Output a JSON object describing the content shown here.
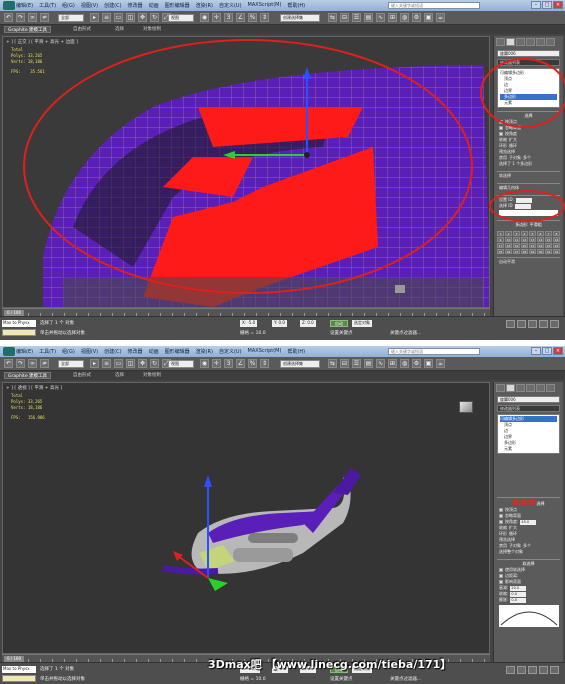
{
  "app": {
    "title": "Autodesk 3ds Max 2013",
    "search_placeholder": "键入关键字或短语",
    "menus": [
      "编辑(E)",
      "工具(T)",
      "组(G)",
      "视图(V)",
      "创建(C)",
      "修改器",
      "动画",
      "图形编辑器",
      "渲染(R)",
      "自定义(U)",
      "MAXScript(M)",
      "帮助(H)"
    ],
    "selection_filter": "全部",
    "ref_coord": "视图",
    "named_selection": "创建选择集",
    "ribbon_tabs": [
      "Graphite 建模工具",
      "自由形式",
      "选择",
      "对象绘制"
    ],
    "colors": {
      "annotation": "#e0201a",
      "mesh_purple": "#5a1fb8",
      "poly_red": "#ff1a1a",
      "selection_blue": "#3670c8"
    }
  },
  "shot1": {
    "viewport_label": "+ ] [ 正交 ] [ 平滑 + 高光 + 边面 ]",
    "stats": {
      "total": "Total",
      "polys": "Polys: 33,265",
      "verts": "Verts: 18,186",
      "fps": "FPS:    35.561"
    },
    "panel": {
      "object_name": "旋翼006",
      "modifier_list": "修改器列表",
      "stack_items": [
        "可编辑多边形",
        "顶点",
        "边",
        "边界",
        "多边形",
        "元素"
      ],
      "selected_stack": "多边形",
      "rollout_select": "选择",
      "by_vertex": "按顶点",
      "ignore_backfacing": "忽略背面",
      "by_angle": "按角度",
      "shrink": "收缩",
      "grow": "扩大",
      "ring": "环形",
      "loop": "循环",
      "preview": "预览选择",
      "disabled": "禁用",
      "sub_object": "子对象",
      "multi": "多个",
      "selected_info": "选择了 1 个多边形",
      "soft_select": "软选择",
      "edit_geometry": "编辑几何体",
      "set_id": "设置 ID:",
      "select_id": "选择 ID",
      "smoothing": "多边形: 平滑组",
      "auto_smooth": "自动平滑"
    },
    "smoothing_groups": [
      "1",
      "2",
      "3",
      "4",
      "5",
      "6",
      "7",
      "8",
      "9",
      "10",
      "11",
      "12",
      "13",
      "14",
      "15",
      "16",
      "17",
      "18",
      "19",
      "20",
      "21",
      "22",
      "23",
      "24",
      "25",
      "26",
      "27",
      "28",
      "29",
      "30",
      "31",
      "32"
    ],
    "timeline": "0 / 100",
    "status": {
      "maxscript": "Max to Physx",
      "line1": "选择了 1 个 对象",
      "line2": "单击并拖动以选择对象",
      "x": "X: -5.0",
      "y": "Y: 0.0",
      "z": "Z: 0.0",
      "grid": "栅格 = 10.0",
      "auto_key": "自动",
      "set_key": "设置关键点",
      "key_filter": "选定对象",
      "add_time_tag": "添加时间标记",
      "key_filters_btn": "关键点过滤器..."
    }
  },
  "shot2": {
    "viewport_label": "+ ] [ 透视 ] [ 平滑 + 高光 ]",
    "stats": {
      "total": "Total",
      "polys": "Polys: 33,265",
      "verts": "Verts: 18,186",
      "fps": "FPS:   156.986"
    },
    "panel": {
      "object_name": "旋翼006",
      "modifier_list": "修改器列表",
      "stack_items": [
        "可编辑多边形",
        "顶点",
        "边",
        "边界",
        "多边形",
        "元素"
      ],
      "selected_stack": "可编辑多边形",
      "rollout_select": "选择",
      "by_vertex": "按顶点",
      "ignore_backfacing": "忽略背面",
      "by_angle": "按角度:",
      "angle_value": "45.0",
      "shrink": "收缩",
      "grow": "扩大",
      "ring": "环形",
      "loop": "循环",
      "preview": "预览选择",
      "disabled": "禁用",
      "sub_object": "子对象",
      "multi": "多个",
      "selected_info": "选择整个对象",
      "soft_select": "软选择",
      "use_soft": "使用软选择",
      "edge_distance": "边距离:",
      "affect_back": "影响背面",
      "falloff": "衰减:",
      "falloff_value": "20.0",
      "pinch": "收缩:",
      "pinch_value": "0.0",
      "bubble": "膨胀:",
      "bubble_value": "0.0"
    },
    "timeline": "0 / 100",
    "status": {
      "maxscript": "Max to Physx",
      "line1": "选择了 1 个 对象",
      "line2": "单击并拖动以选择对象",
      "x": "X: -25.0",
      "y": "Y: -0.0",
      "z": "Z: 0.0",
      "grid": "栅格 = 10.0",
      "auto_key": "自动",
      "set_key": "设置关键点",
      "key_filter": "选定对象",
      "add_time_tag": "添加时间标记",
      "key_filters_btn": "关键点过滤器..."
    }
  },
  "watermark": "3Dmax吧 【www.linecg.com/tieba/171】"
}
